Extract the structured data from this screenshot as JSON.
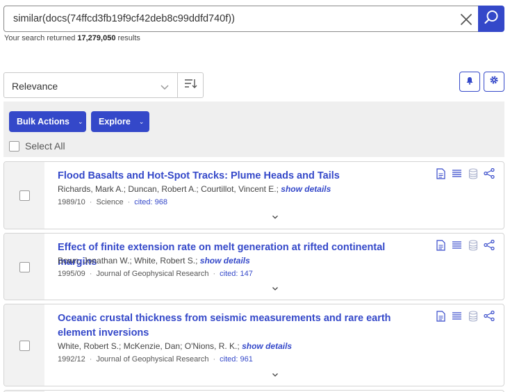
{
  "search": {
    "query": "similar(docs(74ffcd3fb19f9cf42deb8c99ddfd740f))",
    "result_prefix": "Your search returned",
    "result_count": "17,279,050",
    "result_suffix": "results"
  },
  "sort": {
    "selected": "Relevance"
  },
  "actions": {
    "bulk_actions_label": "Bulk Actions",
    "explore_label": "Explore",
    "select_all_label": "Select All"
  },
  "colors": {
    "accent": "#3448c9",
    "gutter": "#f2f2f2",
    "bar": "#efefef"
  },
  "results": [
    {
      "title": "Flood Basalts and Hot-Spot Tracks: Plume Heads and Tails",
      "authors": "Richards, Mark A.; Duncan, Robert A.; Courtillot, Vincent E.;",
      "show_details": "show details",
      "date": "1989/10",
      "venue": "Science",
      "cited": "cited: 968"
    },
    {
      "title": "Effect of finite extension rate on melt generation at rifted continental margins",
      "authors": "Bown, Jonathan W.; White, Robert S.;",
      "show_details": "show details",
      "date": "1995/09",
      "venue": "Journal of Geophysical Research",
      "cited": "cited: 147"
    },
    {
      "title": "Oceanic crustal thickness from seismic measurements and rare earth element inversions",
      "authors": "White, Robert S.; McKenzie, Dan; O'Nions, R. K.;",
      "show_details": "show details",
      "date": "1992/12",
      "venue": "Journal of Geophysical Research",
      "cited": "cited: 961"
    }
  ]
}
